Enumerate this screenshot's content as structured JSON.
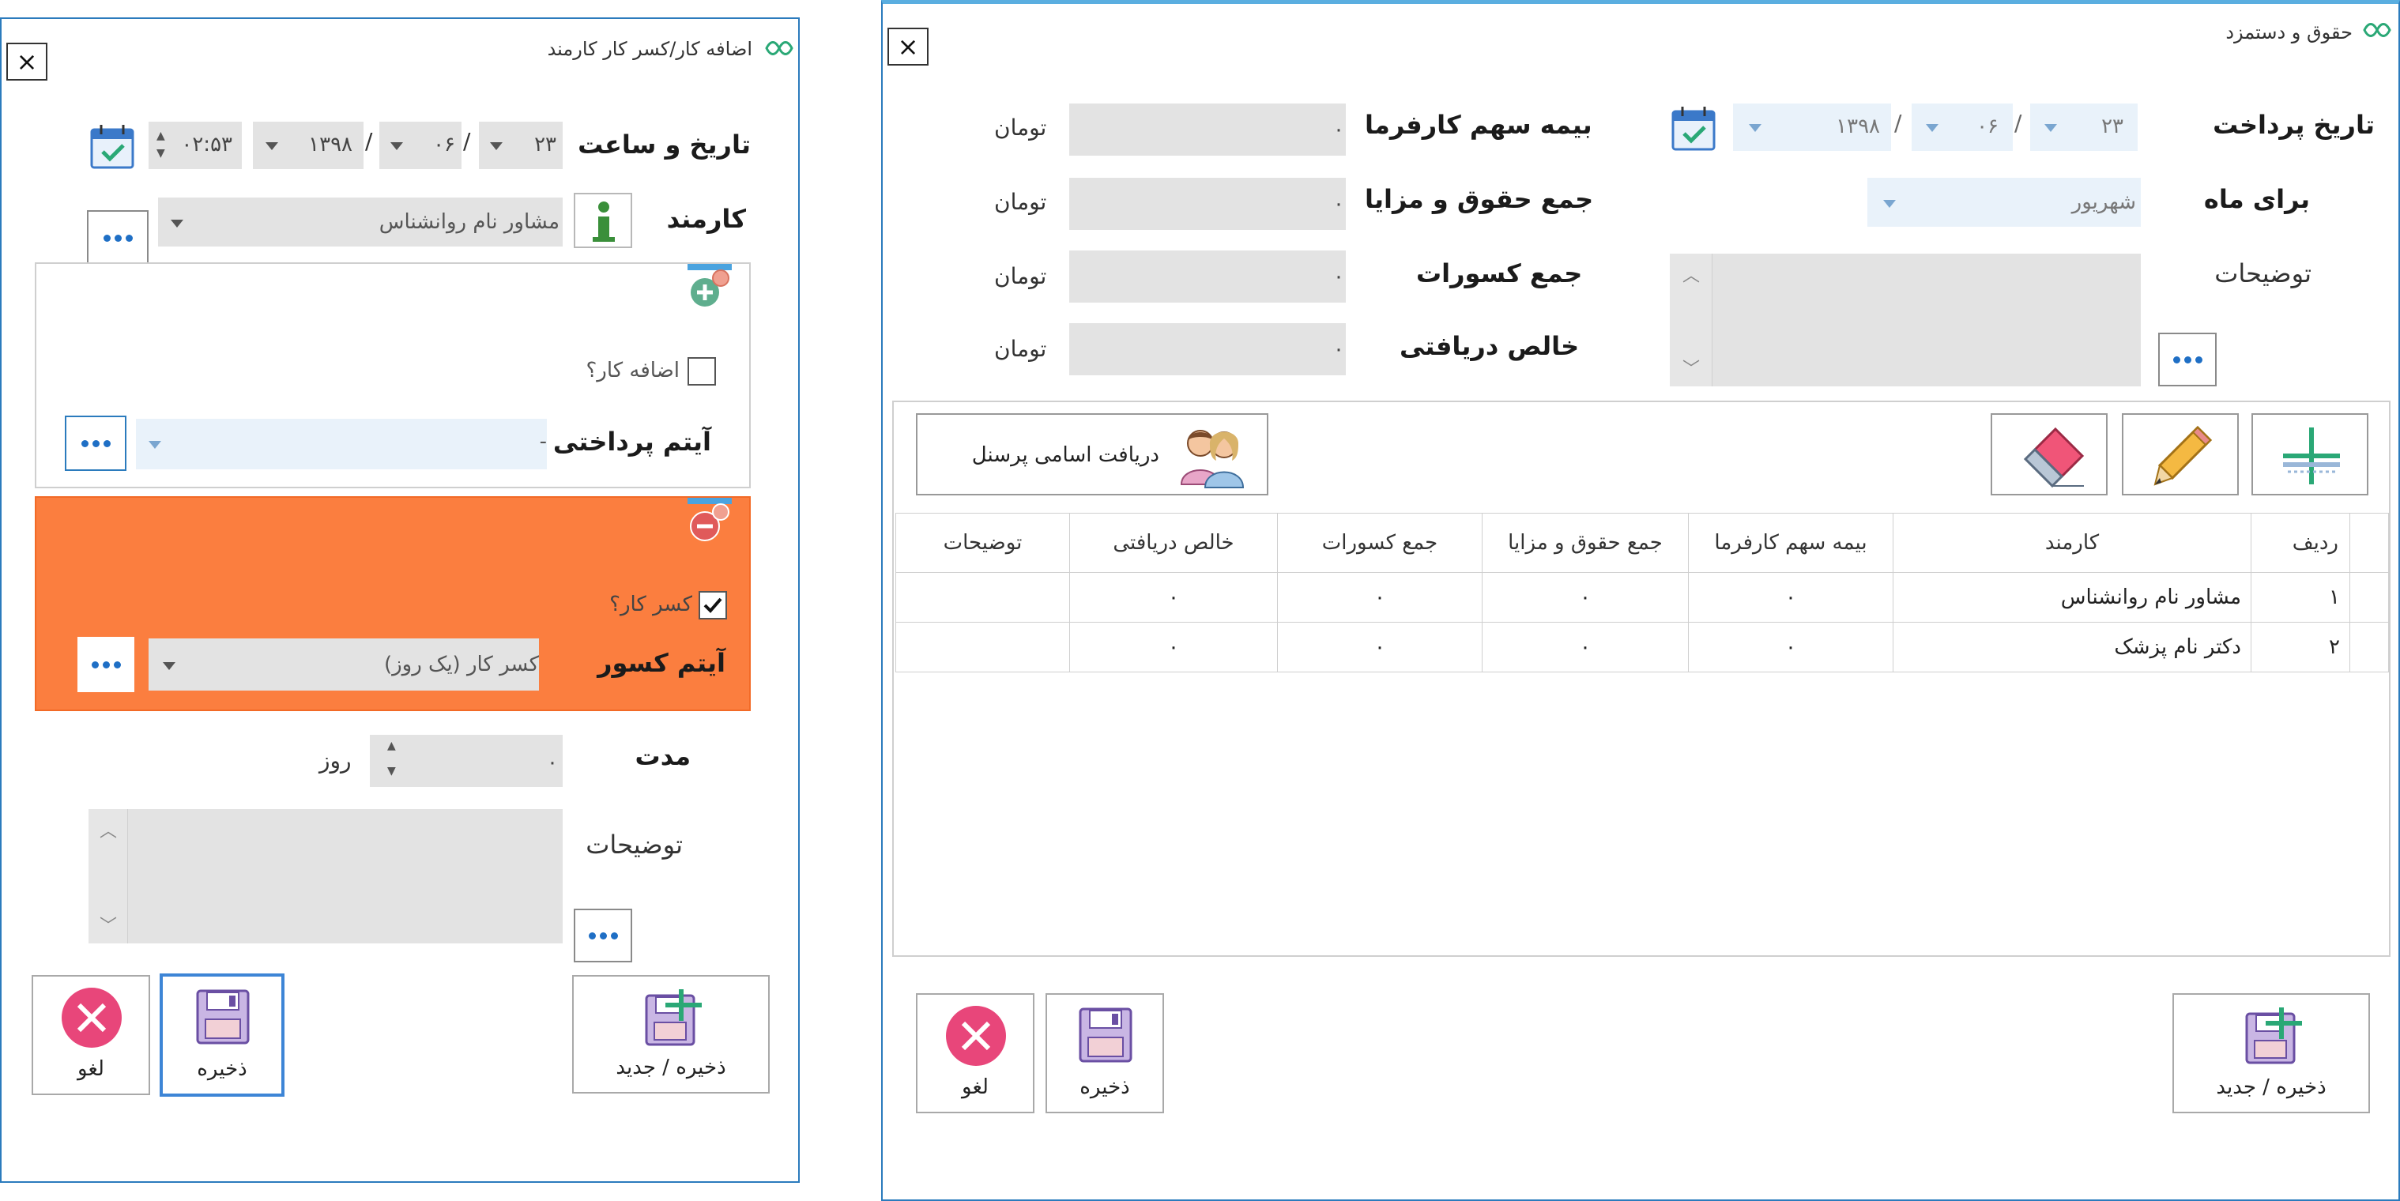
{
  "left_dialog": {
    "title": "اضافه کار/کسر کار کارمند",
    "datetime_label": "تاریخ و ساعت",
    "date_day": "۲۳",
    "date_month": "۰۶",
    "date_year": "۱۳۹۸",
    "time_value": "۰۲:۵۳",
    "employee_label": "کارمند",
    "employee_value": "مشاور نام روانشناس",
    "overtime_checkbox_label": "اضافه کار؟",
    "overtime_checked": false,
    "payment_item_label": "آیتم پرداختی",
    "payment_item_value": "-",
    "deduction_checkbox_label": "کسر کار؟",
    "deduction_checked": true,
    "deduction_item_label": "آیتم کسور",
    "deduction_item_value": "کسر کار (یک روز)",
    "duration_label": "مدت",
    "duration_value": "۰",
    "duration_unit": "روز",
    "description_label": "توضیحات",
    "buttons": {
      "save_new": "ذخیره / جدید",
      "save": "ذخیره",
      "cancel": "لغو"
    },
    "deduction_panel_color": "#fb7e3f"
  },
  "right_dialog": {
    "title": "حقوق و دستمزد",
    "payment_date_label": "تاریخ پرداخت",
    "date_day": "۲۳",
    "date_month": "۰۶",
    "date_year": "۱۳۹۸",
    "month_label": "برای ماه",
    "month_value": "شهریور",
    "description_label": "توضیحات",
    "summary": [
      {
        "label": "بیمه سهم کارفرما",
        "value": "۰",
        "unit": "تومان"
      },
      {
        "label": "جمع حقوق و مزایا",
        "value": "۰",
        "unit": "تومان"
      },
      {
        "label": "جمع کسورات",
        "value": "۰",
        "unit": "تومان"
      },
      {
        "label": "خالص دریافتی",
        "value": "۰",
        "unit": "تومان"
      }
    ],
    "toolbar": {
      "get_personnel": "دریافت اسامی پرسنل"
    },
    "table": {
      "headers": [
        "ردیف",
        "کارمند",
        "بیمه سهم کارفرما",
        "جمع حقوق و مزایا",
        "جمع کسورات",
        "خالص دریافتی",
        "توضیحات"
      ],
      "rows": [
        [
          "۱",
          "مشاور نام روانشناس",
          "۰",
          "۰",
          "۰",
          "۰",
          ""
        ],
        [
          "۲",
          "دکتر نام پزشک",
          "۰",
          "۰",
          "۰",
          "۰",
          ""
        ]
      ]
    },
    "buttons": {
      "save_new": "ذخیره / جدید",
      "save": "ذخیره",
      "cancel": "لغو"
    }
  }
}
